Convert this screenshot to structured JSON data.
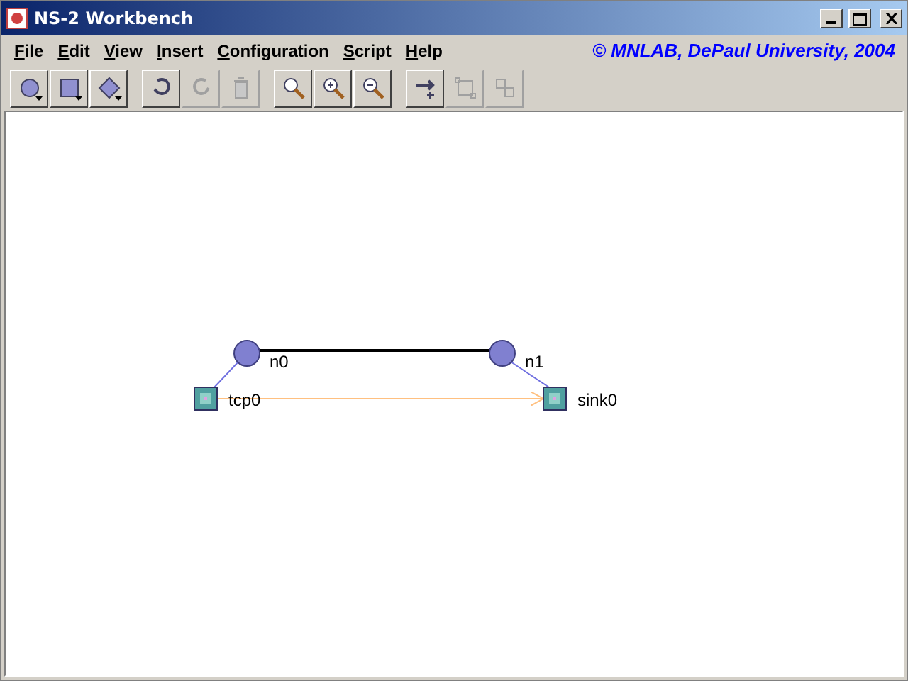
{
  "window": {
    "title": "NS-2 Workbench"
  },
  "menu": [
    "File",
    "Edit",
    "View",
    "Insert",
    "Configuration",
    "Script",
    "Help"
  ],
  "copyright": "© MNLAB, DePaul University, 2004",
  "toolbar_groups": [
    {
      "buttons": [
        {
          "kind": "node",
          "dropdown": true,
          "disabled": false
        },
        {
          "kind": "square",
          "dropdown": true,
          "disabled": false
        },
        {
          "kind": "diamond",
          "dropdown": true,
          "disabled": false
        }
      ]
    },
    {
      "buttons": [
        {
          "kind": "undo",
          "dropdown": false,
          "disabled": false
        },
        {
          "kind": "redo",
          "dropdown": false,
          "disabled": true
        },
        {
          "kind": "trash",
          "dropdown": false,
          "disabled": true
        }
      ]
    },
    {
      "buttons": [
        {
          "kind": "zoom",
          "dropdown": false,
          "disabled": false
        },
        {
          "kind": "zoomin",
          "dropdown": false,
          "disabled": false
        },
        {
          "kind": "zoomout",
          "dropdown": false,
          "disabled": false
        }
      ]
    },
    {
      "buttons": [
        {
          "kind": "link",
          "dropdown": false,
          "disabled": false
        },
        {
          "kind": "group",
          "dropdown": false,
          "disabled": true
        },
        {
          "kind": "ungroup",
          "dropdown": false,
          "disabled": true
        }
      ]
    }
  ],
  "canvas": {
    "items": [
      {
        "kind": "node",
        "label": "n0"
      },
      {
        "kind": "node",
        "label": "n1"
      },
      {
        "kind": "agent",
        "label": "tcp0"
      },
      {
        "kind": "agent",
        "label": "sink0"
      }
    ],
    "links": [
      {
        "kind": "duplex"
      },
      {
        "kind": "attach"
      },
      {
        "kind": "attach"
      },
      {
        "kind": "connection"
      }
    ]
  }
}
